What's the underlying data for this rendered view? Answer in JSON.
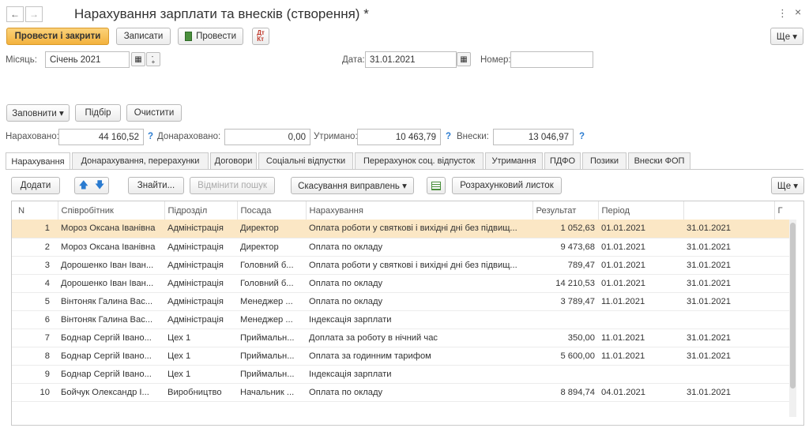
{
  "window": {
    "title": "Нарахування зарплати та внесків (створення) *",
    "menu_dots": "⋮",
    "close_glyph": "×",
    "back_glyph": "←",
    "forward_glyph": "→"
  },
  "toolbar": {
    "post_close_label": "Провести і закрити",
    "save_label": "Записати",
    "post_label": "Провести",
    "more_label": "Ще ▾"
  },
  "header": {
    "month_label": "Місяць:",
    "month_value": "Січень 2021",
    "date_label": "Дата:",
    "date_value": "31.01.2021",
    "number_label": "Номер:",
    "number_value": ""
  },
  "actions": {
    "fill_label": "Заповнити ▾",
    "select_label": "Підбір",
    "clear_label": "Очистити"
  },
  "totals": {
    "accrued_label": "Нараховано:",
    "accrued_value": "44 160,52",
    "additional_label": "Донараховано:",
    "additional_value": "0,00",
    "withheld_label": "Утримано:",
    "withheld_value": "10 463,79",
    "contrib_label": "Внески:",
    "contrib_value": "13 046,97",
    "help": "?"
  },
  "tabs": [
    "Нарахування",
    "Донарахування, перерахунки",
    "Договори",
    "Соціальні відпустки",
    "Перерахунок соц. відпусток",
    "Утримання",
    "ПДФО",
    "Позики",
    "Внески ФОП"
  ],
  "grid_toolbar": {
    "add_label": "Додати",
    "find_label": "Знайти...",
    "cancel_search_label": "Відмінити пошук",
    "cancel_corrections_label": "Скасування виправлень ▾",
    "payslip_label": "Розрахунковий листок",
    "more_label": "Ще ▾"
  },
  "table": {
    "columns": [
      "N",
      "Співробітник",
      "Підрозділ",
      "Посада",
      "Нарахування",
      "Результат",
      "Період",
      "",
      "Г"
    ],
    "rows": [
      [
        "1",
        "Мороз Оксана Іванівна",
        "Адміністрація",
        "Директор",
        "Оплата роботи у святкові і вихідні дні без підвищ...",
        "1 052,63",
        "01.01.2021",
        "31.01.2021"
      ],
      [
        "2",
        "Мороз Оксана Іванівна",
        "Адміністрація",
        "Директор",
        "Оплата по окладу",
        "9 473,68",
        "01.01.2021",
        "31.01.2021"
      ],
      [
        "3",
        "Дорошенко Іван Іван...",
        "Адміністрація",
        "Головний б...",
        "Оплата роботи у святкові і вихідні дні без підвищ...",
        "789,47",
        "01.01.2021",
        "31.01.2021"
      ],
      [
        "4",
        "Дорошенко Іван Іван...",
        "Адміністрація",
        "Головний б...",
        "Оплата по окладу",
        "14 210,53",
        "01.01.2021",
        "31.01.2021"
      ],
      [
        "5",
        "Вінтоняк Галина Вас...",
        "Адміністрація",
        "Менеджер ...",
        "Оплата по окладу",
        "3 789,47",
        "11.01.2021",
        "31.01.2021"
      ],
      [
        "6",
        "Вінтоняк Галина Вас...",
        "Адміністрація",
        "Менеджер ...",
        "Індексація зарплати",
        "",
        "",
        ""
      ],
      [
        "7",
        "Боднар Сергій Івано...",
        "Цех 1",
        "Приймальн...",
        "Доплата за роботу в нічний час",
        "350,00",
        "11.01.2021",
        "31.01.2021"
      ],
      [
        "8",
        "Боднар Сергій Івано...",
        "Цех 1",
        "Приймальн...",
        "Оплата за годинним тарифом",
        "5 600,00",
        "11.01.2021",
        "31.01.2021"
      ],
      [
        "9",
        "Боднар Сергій Івано...",
        "Цех 1",
        "Приймальн...",
        "Індексація зарплати",
        "",
        "",
        ""
      ],
      [
        "10",
        "Бойчук Олександр І...",
        "Виробництво",
        "Начальник ...",
        "Оплата по окладу",
        "8 894,74",
        "04.01.2021",
        "31.01.2021"
      ]
    ]
  },
  "colors": {
    "accent": "#f3b23d",
    "selected_row": "#fbe7c5",
    "link_blue": "#2a7bd0"
  }
}
